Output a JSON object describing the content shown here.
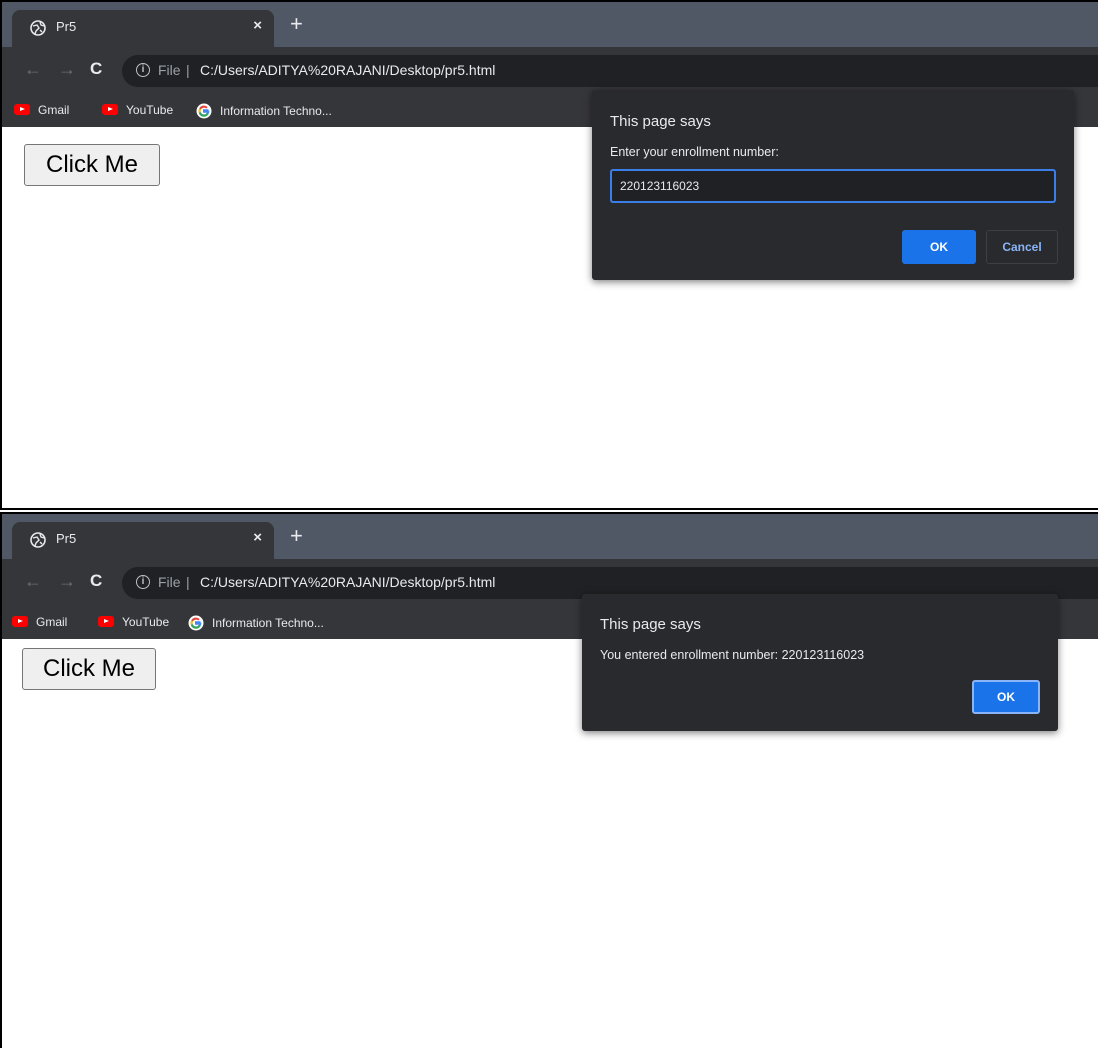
{
  "browser": {
    "tab_title": "Pr5",
    "tab_close": "×",
    "new_tab": "+",
    "nav": {
      "back": "←",
      "forward": "→",
      "reload": "C"
    },
    "address": {
      "info": "i",
      "scheme_label": "File",
      "separator": "|",
      "url": "C:/Users/ADITYA%20RAJANI/Desktop/pr5.html"
    },
    "bookmarks": [
      {
        "label": "Gmail",
        "icon": "youtube-icon"
      },
      {
        "label": "YouTube",
        "icon": "youtube-icon"
      },
      {
        "label": "Information Techno...",
        "icon": "google-icon"
      }
    ]
  },
  "page": {
    "button_label": "Click Me"
  },
  "prompt_dialog": {
    "title": "This page says",
    "message": "Enter your enrollment number:",
    "input_value": "220123116023",
    "ok_label": "OK",
    "cancel_label": "Cancel"
  },
  "alert_dialog": {
    "title": "This page says",
    "message": "You entered enrollment number: 220123116023",
    "ok_label": "OK"
  },
  "colors": {
    "tabstrip": "#4f5864",
    "toolbar": "#35363a",
    "dialog": "#292a2d",
    "accent": "#1a73e8"
  }
}
